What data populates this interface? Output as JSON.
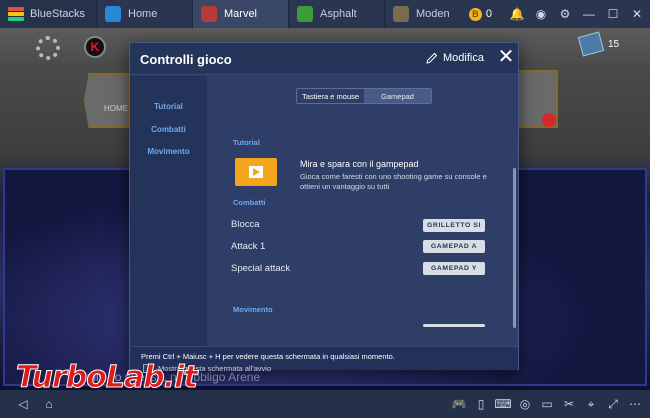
{
  "titlebar": {
    "app_name": "BlueStacks",
    "tabs": [
      {
        "label": "Home",
        "icon": "home-icon",
        "color": "#2b88d8"
      },
      {
        "label": "Marvel",
        "icon": "marvel-game-icon",
        "color": "#b83b3b"
      },
      {
        "label": "Asphalt",
        "icon": "asphalt-game-icon",
        "color": "#3c9b3c"
      },
      {
        "label": "Moden",
        "icon": "moden-game-icon",
        "color": "#7a6a50"
      }
    ],
    "coin_symbol": "B",
    "coin_count": "0"
  },
  "game": {
    "home_label": "HOME",
    "badge_letter": "K",
    "gem_count": "15",
    "bottom_text": "nully no stress... no obbligo Arene"
  },
  "dialog": {
    "title": "Controlli gioco",
    "edit_label": "Modifica",
    "close_symbol": "✕",
    "sidebar": {
      "items": [
        "Tutorial",
        "Combatti",
        "Movimento"
      ]
    },
    "mode_toggle": {
      "options": [
        "Tastiera e mouse",
        "Gamepad"
      ],
      "selected": "Gamepad"
    },
    "sections": {
      "tutorial": {
        "heading": "Tutorial",
        "title": "Mira e spara con il gampepad",
        "description": "Gioca come faresti con uno shooting game su console e ottieni un vantaggio su tutti"
      },
      "combatti": {
        "heading": "Combatti",
        "rows": [
          {
            "label": "Blocca",
            "key": "GRILLETTO SI"
          },
          {
            "label": "Attack 1",
            "key": "GAMEPAD A"
          },
          {
            "label": "Special attack",
            "key": "GAMEPAD Y"
          }
        ]
      },
      "movimento": {
        "heading": "Movimento"
      }
    },
    "footer": {
      "hint": "Premi Ctrl + Maiusc + H per vedere questa schermata in qualsiasi momento.",
      "checkbox_label": "Mostra questa schermata all'avvio"
    }
  },
  "watermark": "TurboLab.it"
}
